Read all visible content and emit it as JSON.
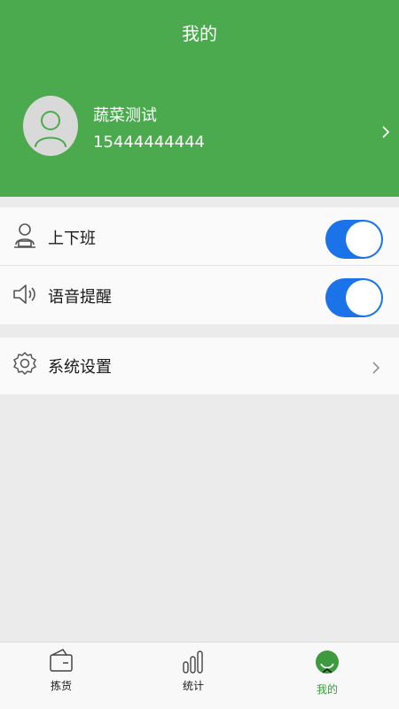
{
  "header": {
    "title": "我的"
  },
  "profile": {
    "name": "蔬菜测试",
    "phone": "15444444444"
  },
  "settings": {
    "work_toggle": {
      "label": "上下班",
      "on": true
    },
    "voice_toggle": {
      "label": "语音提醒",
      "on": true
    },
    "system": {
      "label": "系统设置"
    }
  },
  "nav": {
    "pick": "拣货",
    "stats": "统计",
    "mine": "我的"
  },
  "colors": {
    "brand_green": "#4caa4e",
    "toggle_blue": "#1a73e8",
    "active_nav": "#3d9a3f"
  }
}
